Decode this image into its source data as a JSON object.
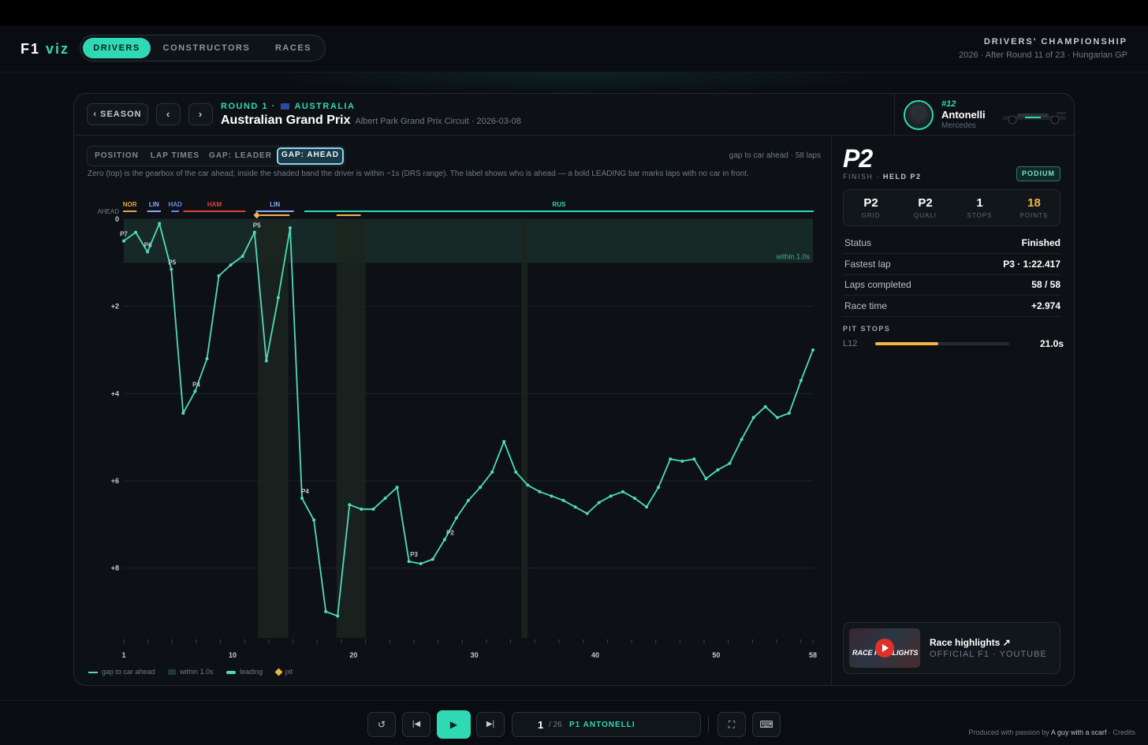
{
  "app": {
    "logo_main": "F1",
    "logo_accent": "viz"
  },
  "nav": {
    "items": [
      "DRIVERS",
      "CONSTRUCTORS",
      "RACES"
    ],
    "active": "DRIVERS"
  },
  "championship": {
    "title": "DRIVERS' CHAMPIONSHIP",
    "subtitle": "2026 · After Round 11 of 23 · Hungarian GP"
  },
  "race": {
    "season_button": "‹ SEASON",
    "prev": "‹",
    "next": "›",
    "round_label": "ROUND 1 ·",
    "country": "AUSTRALIA",
    "name": "Australian Grand Prix",
    "subtitle": "Albert Park Grand Prix Circuit · 2026-03-08"
  },
  "driver": {
    "number": "#12",
    "name": "Antonelli",
    "team": "Mercedes"
  },
  "tabs": [
    "POSITION",
    "LAP TIMES",
    "GAP: LEADER",
    "GAP: AHEAD"
  ],
  "active_tab": "GAP: AHEAD",
  "chart_note": "gap to car ahead · 58 laps",
  "chart_description": "Zero (top) is the gearbox of the car ahead; inside the shaded band the driver is within ~1s (DRS range). The label shows who is ahead — a bold LEADING bar marks laps with no car in front.",
  "chart_data": {
    "type": "line",
    "ylabel_top": "AHEAD",
    "y_ticks": [
      "0",
      "+2",
      "+4",
      "+6",
      "+8"
    ],
    "x_ticks": [
      1,
      10,
      20,
      30,
      40,
      50,
      58
    ],
    "ylim": [
      0,
      9.6
    ],
    "xlim": [
      1,
      58
    ],
    "drs_band": 1.0,
    "drs_label": "within 1.0s",
    "x": [
      1,
      2,
      3,
      4,
      5,
      6,
      7,
      8,
      9,
      10,
      11,
      12,
      13,
      14,
      15,
      16,
      17,
      18,
      19,
      20,
      21,
      22,
      23,
      24,
      25,
      26,
      27,
      28,
      29,
      30,
      31,
      32,
      33,
      34,
      35,
      36,
      37,
      38,
      39,
      40,
      41,
      42,
      43,
      44,
      45,
      46,
      47,
      48,
      49,
      50,
      51,
      52,
      53,
      54,
      55,
      56,
      57,
      58
    ],
    "series": [
      {
        "values": [
          0.5,
          0.3,
          0.75,
          0.1,
          1.15,
          4.45,
          3.95,
          3.2,
          1.3,
          1.05,
          0.85,
          0.3,
          3.25,
          1.8,
          0.2,
          6.4,
          6.9,
          9.0,
          9.1,
          6.55,
          6.65,
          6.65,
          6.4,
          6.15,
          7.85,
          7.9,
          7.8,
          7.35,
          6.85,
          6.45,
          6.15,
          5.8,
          5.1,
          5.8,
          6.1,
          6.25,
          6.35,
          6.45,
          6.6,
          6.75,
          6.5,
          6.35,
          6.25,
          6.4,
          6.6,
          6.15,
          5.5,
          5.55,
          5.5,
          5.95,
          5.75,
          5.6,
          5.05,
          4.55,
          4.3,
          4.55,
          4.45,
          3.7,
          3.0
        ]
      }
    ],
    "position_labels": [
      {
        "x": 1,
        "label": "P7"
      },
      {
        "x": 3,
        "label": "P6"
      },
      {
        "x": 5,
        "label": "P5"
      },
      {
        "x": 7,
        "label": "P4"
      },
      {
        "x": 12,
        "label": "P5"
      },
      {
        "x": 16,
        "label": "P4"
      },
      {
        "x": 25,
        "label": "P3"
      },
      {
        "x": 28,
        "label": "P2"
      }
    ],
    "ahead_labels": [
      {
        "label": "NOR",
        "from": 1,
        "to": 2,
        "color": "#f2a03d"
      },
      {
        "label": "LIN",
        "from": 3,
        "to": 4,
        "color": "#8fa8ff"
      },
      {
        "label": "HAD",
        "from": 5,
        "to": 5.5,
        "color": "#6f86e8"
      },
      {
        "label": "HAM",
        "from": 6,
        "to": 11,
        "color": "#e0403a"
      },
      {
        "label": "LIN",
        "from": 12,
        "to": 15,
        "color": "#8fa8ff"
      },
      {
        "label": "RUS",
        "from": 16,
        "to": 58,
        "color": "#2fd9b4"
      }
    ],
    "pit_shades": [
      [
        12.1,
        14.6
      ],
      [
        18.6,
        21.0
      ],
      [
        33.9,
        34.4
      ]
    ],
    "pit_marker_lap": 12,
    "legend": [
      "gap to car ahead",
      "within 1.0s",
      "leading",
      "pit"
    ],
    "colors": {
      "line": "#4fdcbc",
      "pit": "#f2b24a",
      "band": "#1a2f2a"
    }
  },
  "result": {
    "position": "P2",
    "finish_label": "FINISH ·",
    "held": "HELD P2",
    "badge": "PODIUM",
    "stats": [
      {
        "value": "P2",
        "label": "GRID"
      },
      {
        "value": "P2",
        "label": "QUALI"
      },
      {
        "value": "1",
        "label": "STOPS"
      },
      {
        "value": "18",
        "label": "POINTS"
      }
    ],
    "rows": [
      {
        "k": "Status",
        "v": "Finished"
      },
      {
        "k": "Fastest lap",
        "v": "P3 · 1:22.417"
      },
      {
        "k": "Laps completed",
        "v": "58 / 58"
      },
      {
        "k": "Race time",
        "v": "+2.974"
      }
    ],
    "pit_title": "PIT STOPS",
    "pit_lap": "L12",
    "pit_time": "21.0s",
    "pit_fraction": 0.47
  },
  "highlights": {
    "title": "Race highlights ↗",
    "subtitle": "OFFICIAL F1 · YOUTUBE",
    "thumb_text": "RACE HIGHLIGHTS"
  },
  "player": {
    "current": "1",
    "total": "/ 26",
    "label": "P1 ANTONELLI"
  },
  "credit": {
    "prefix": "Produced with passion by",
    "author": "A guy with a scarf",
    "suffix": "· Credits"
  }
}
